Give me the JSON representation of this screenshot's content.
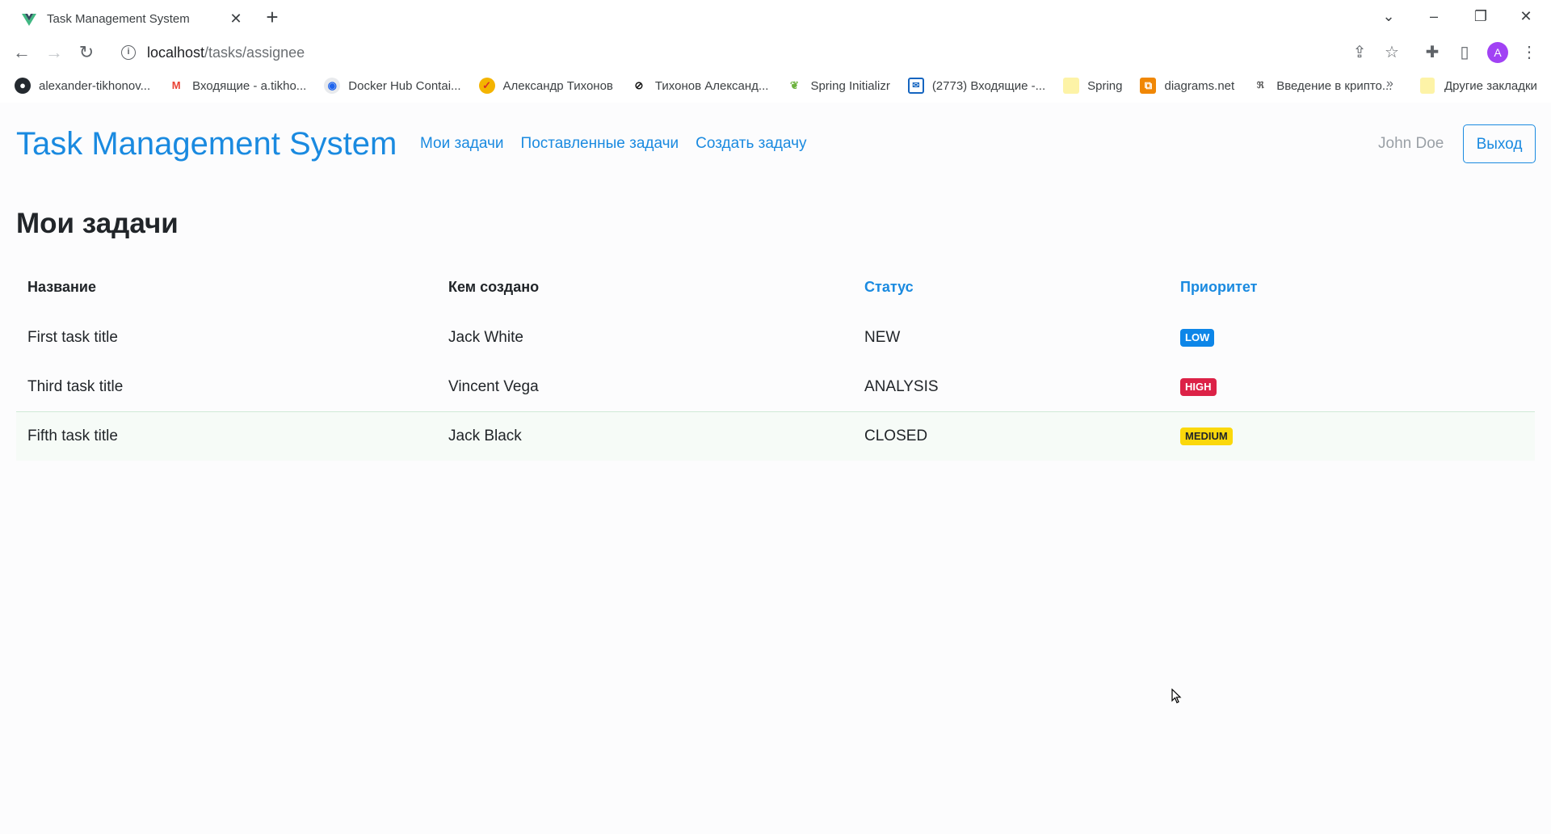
{
  "browser": {
    "tab_title": "Task Management System",
    "url_host": "localhost",
    "url_path": "/tasks/assignee",
    "profile_initial": "A",
    "bookmarks": [
      {
        "label": "alexander-tikhonov...",
        "icon": "github-icon"
      },
      {
        "label": "Входящие - a.tikho...",
        "icon": "gmail-icon"
      },
      {
        "label": "Docker Hub Contai...",
        "icon": "docker-icon"
      },
      {
        "label": "Александр Тихонов",
        "icon": "profile-icon"
      },
      {
        "label": "Тихонов Александ...",
        "icon": "hh-icon"
      },
      {
        "label": "Spring Initializr",
        "icon": "spring-icon"
      },
      {
        "label": "(2773) Входящие -...",
        "icon": "mail-icon"
      },
      {
        "label": "Spring",
        "icon": "folder-icon"
      },
      {
        "label": "diagrams.net",
        "icon": "drawio-icon"
      },
      {
        "label": "Введение в крипто...",
        "icon": "crypto-icon"
      }
    ],
    "bookmarks_more": "»",
    "other_bookmarks": "Другие закладки"
  },
  "app": {
    "brand": "Task Management System",
    "nav": {
      "my_tasks": "Мои задачи",
      "assigned_tasks": "Поставленные задачи",
      "create_task": "Создать задачу"
    },
    "user_name": "John Doe",
    "logout_label": "Выход",
    "page_title": "Мои задачи",
    "table": {
      "headers": {
        "name": "Название",
        "created_by": "Кем создано",
        "status": "Статус",
        "priority": "Приоритет"
      },
      "rows": [
        {
          "name": "First task title",
          "created_by": "Jack White",
          "status": "NEW",
          "priority": "LOW"
        },
        {
          "name": "Third task title",
          "created_by": "Vincent Vega",
          "status": "ANALYSIS",
          "priority": "HIGH"
        },
        {
          "name": "Fifth task title",
          "created_by": "Jack Black",
          "status": "CLOSED",
          "priority": "MEDIUM"
        }
      ]
    },
    "priority_colors": {
      "LOW": {
        "bg": "#0d86e8",
        "fg": "#ffffff"
      },
      "HIGH": {
        "bg": "#dc2247",
        "fg": "#ffffff"
      },
      "MEDIUM": {
        "bg": "#fbd80b",
        "fg": "#212529"
      }
    },
    "accent_color": "#1a8ae0"
  }
}
